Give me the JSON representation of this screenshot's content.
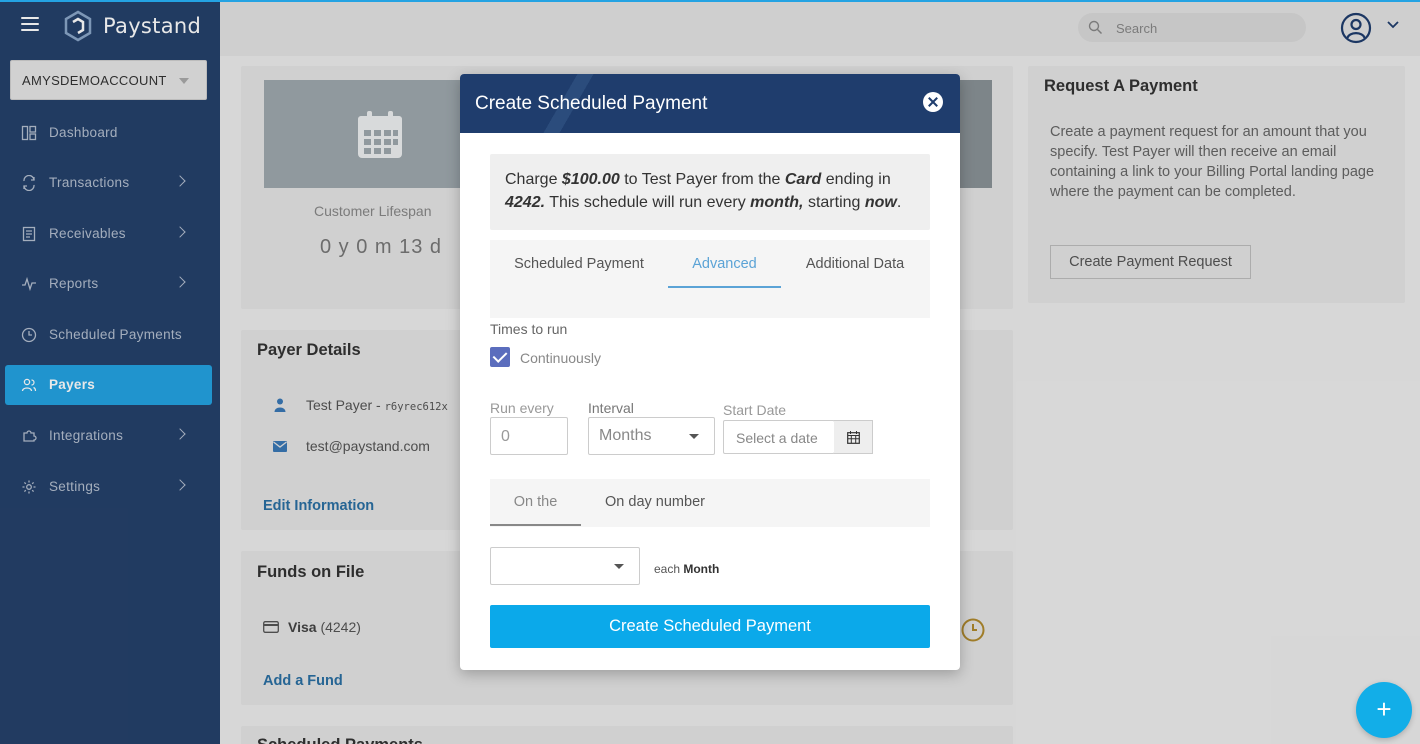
{
  "app": {
    "name": "Paystand"
  },
  "colors": {
    "sidebar": "#25416b",
    "accent": "#24a3e3",
    "primary_button": "#0ba9ea",
    "modal_header": "#1f3d6d"
  },
  "sidebar": {
    "account": "AMYSDEMOACCOUNT",
    "items": [
      {
        "label": "Dashboard",
        "icon": "dashboard-icon"
      },
      {
        "label": "Transactions",
        "icon": "transactions-icon"
      },
      {
        "label": "Receivables",
        "icon": "receivables-icon"
      },
      {
        "label": "Reports",
        "icon": "reports-icon"
      },
      {
        "label": "Scheduled Payments",
        "icon": "clock-icon"
      },
      {
        "label": "Payers",
        "icon": "users-icon",
        "active": true
      },
      {
        "label": "Integrations",
        "icon": "integrations-icon"
      },
      {
        "label": "Settings",
        "icon": "gear-icon"
      }
    ]
  },
  "topbar": {
    "search_placeholder": "Search"
  },
  "main": {
    "lifespan_label": "Customer Lifespan",
    "lifespan_value": "0 y 0 m 13 d",
    "payer_details": {
      "title": "Payer Details",
      "name": "Test Payer - ",
      "id_fragment": "r6yrec612x",
      "email": "test@paystand.com",
      "edit_link": "Edit Information"
    },
    "funds": {
      "title": "Funds on File",
      "card_brand": "Visa",
      "card_last4": "(4242)",
      "add_link": "Add a Fund"
    },
    "scheduled_title": "Scheduled Payments",
    "request": {
      "title": "Request A Payment",
      "description": "Create a payment request for an amount that you specify. Test Payer will then receive an email containing a link to your Billing Portal landing page where the payment can be completed.",
      "button": "Create Payment Request"
    }
  },
  "modal": {
    "title": "Create Scheduled Payment",
    "summary": {
      "t1": "Charge ",
      "amount": "$100.00",
      "t2": " to Test Payer from the ",
      "method": "Card",
      "t3": " ending in ",
      "last4": "4242.",
      "t4": "  This schedule will run every ",
      "period": "month,",
      "t5": " starting ",
      "start": "now",
      "t6": "."
    },
    "tabs": [
      "Scheduled Payment",
      "Advanced",
      "Additional Data"
    ],
    "active_tab": "Advanced",
    "times_label": "Times to run",
    "continuously_label": "Continuously",
    "continuously_checked": true,
    "run_every_label": "Run every",
    "run_every_placeholder": "0",
    "interval_label": "Interval",
    "interval_value": "Months",
    "start_label": "Start Date",
    "start_placeholder": "Select a date",
    "subtabs": [
      "On the",
      "On day number"
    ],
    "each_prefix": "each ",
    "each_unit": "Month",
    "submit": "Create Scheduled Payment"
  }
}
